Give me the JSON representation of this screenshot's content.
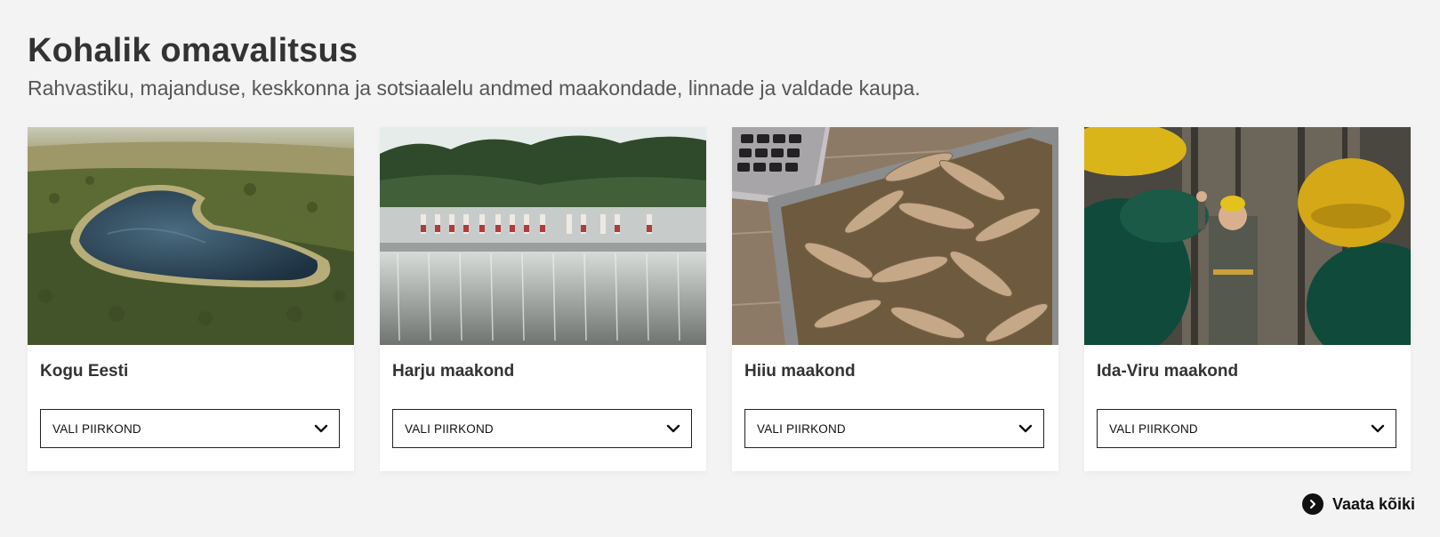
{
  "section": {
    "title": "Kohalik omavalitsus",
    "subtitle": "Rahvastiku, majanduse, keskkonna ja sotsiaalelu andmed maakondade, linnade ja valdade kaupa."
  },
  "cards": [
    {
      "title": "Kogu Eesti",
      "select_label": "VALI PIIRKOND",
      "image": "aerial-heart-shaped-lake-photo"
    },
    {
      "title": "Harju maakond",
      "select_label": "VALI PIIRKOND",
      "image": "waterfall-folk-dancers-photo"
    },
    {
      "title": "Hiiu maakond",
      "select_label": "VALI PIIRKOND",
      "image": "fried-fish-tray-laptop-photo"
    },
    {
      "title": "Ida-Viru maakond",
      "select_label": "VALI PIIRKOND",
      "image": "mine-workers-hardhats-photo"
    }
  ],
  "view_all": {
    "label": "Vaata kõiki",
    "icon": "chevron-right-circle-icon"
  }
}
